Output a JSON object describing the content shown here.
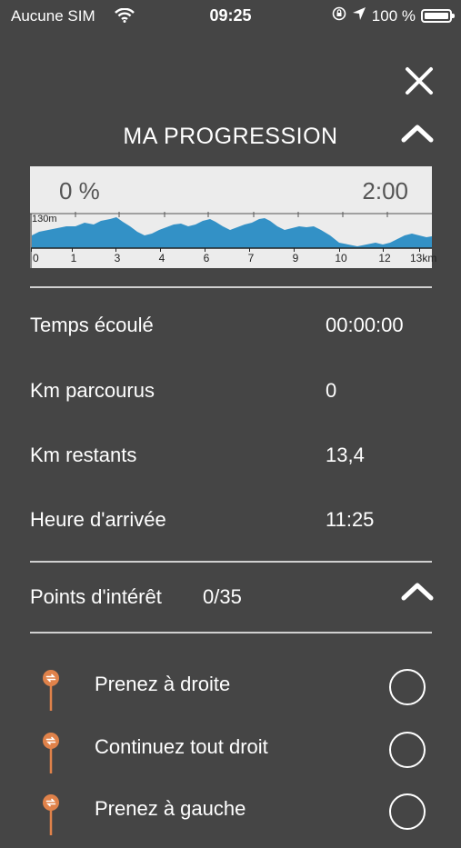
{
  "status_bar": {
    "carrier": "Aucune SIM",
    "time": "09:25",
    "battery": "100 %"
  },
  "header": {
    "title": "MA PROGRESSION"
  },
  "profile": {
    "progress": "0 %",
    "duration": "2:00",
    "elevation_label": "130m",
    "tick_labels": [
      "0",
      "1",
      "3",
      "4",
      "6",
      "7",
      "9",
      "10",
      "12",
      "13km"
    ],
    "fill_color": "#3391c6"
  },
  "stats": [
    {
      "label": "Temps écoulé",
      "value": "00:00:00"
    },
    {
      "label": "Km parcourus",
      "value": "0"
    },
    {
      "label": "Km restants",
      "value": "13,4"
    },
    {
      "label": "Heure d'arrivée",
      "value": "11:25"
    }
  ],
  "poi": {
    "title": "Points d'intérêt",
    "count": "0/35",
    "items": [
      {
        "label": "Prenez à droite"
      },
      {
        "label": "Continuez tout droit"
      },
      {
        "label": "Prenez à gauche"
      }
    ],
    "pin_color": "#e0824a"
  }
}
